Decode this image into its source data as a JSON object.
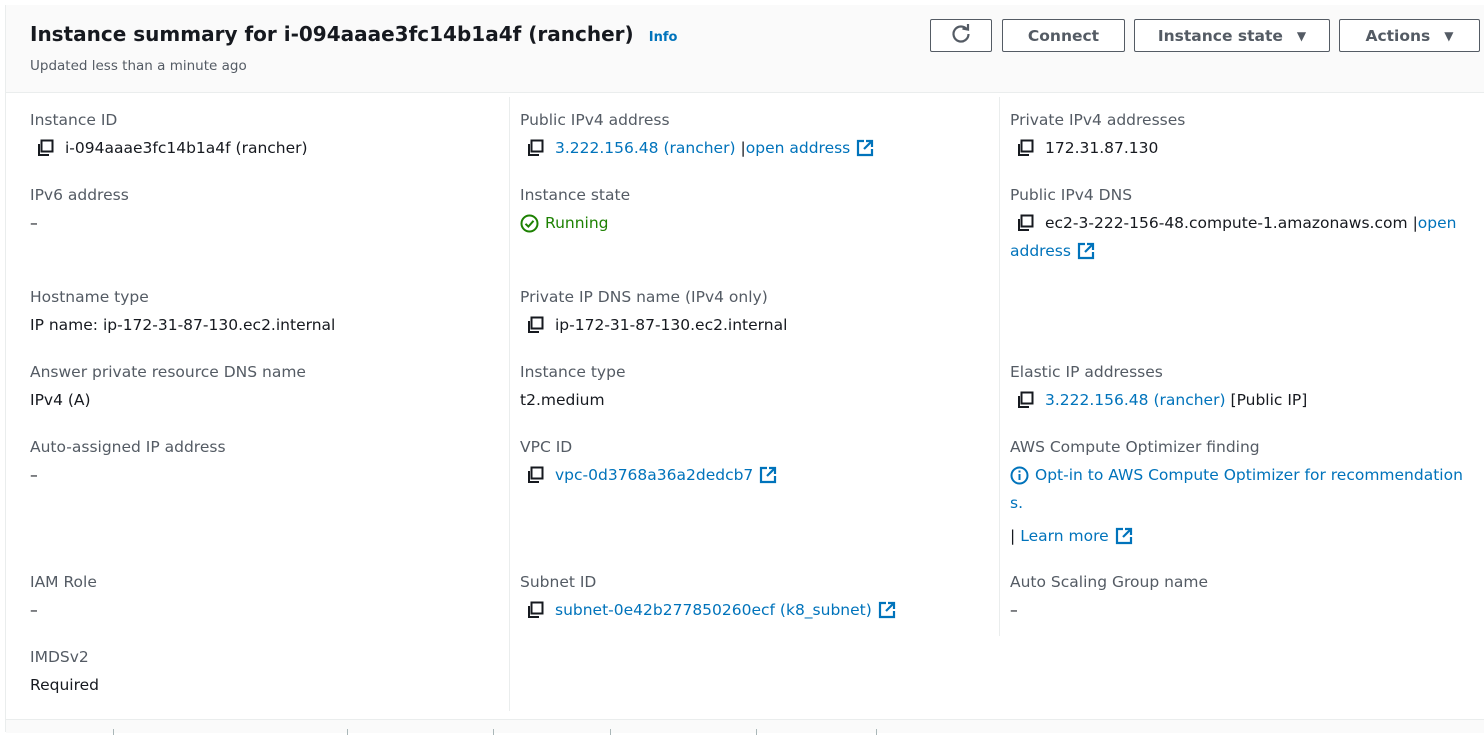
{
  "header": {
    "title": "Instance summary for i-094aaae3fc14b1a4f (rancher)",
    "info_label": "Info",
    "updated": "Updated less than a minute ago",
    "buttons": {
      "connect": "Connect",
      "instance_state": "Instance state",
      "actions": "Actions"
    }
  },
  "fields": {
    "instance_id": {
      "label": "Instance ID",
      "value": "i-094aaae3fc14b1a4f (rancher)"
    },
    "public_ipv4": {
      "label": "Public IPv4 address",
      "value": "3.222.156.48 (rancher)",
      "separator": "|",
      "open_address": "open address"
    },
    "private_ipv4": {
      "label": "Private IPv4 addresses",
      "value": "172.31.87.130"
    },
    "ipv6": {
      "label": "IPv6 address",
      "value": "–"
    },
    "instance_state": {
      "label": "Instance state",
      "value": "Running"
    },
    "public_dns": {
      "label": "Public IPv4 DNS",
      "value": "ec2-3-222-156-48.compute-1.amazonaws.com",
      "separator": "|",
      "open_address_1": "open",
      "open_address_2": "address"
    },
    "hostname_type": {
      "label": "Hostname type",
      "value": "IP name: ip-172-31-87-130.ec2.internal"
    },
    "private_dns": {
      "label": "Private IP DNS name (IPv4 only)",
      "value": "ip-172-31-87-130.ec2.internal"
    },
    "answer_dns": {
      "label": "Answer private resource DNS name",
      "value": "IPv4 (A)"
    },
    "instance_type": {
      "label": "Instance type",
      "value": "t2.medium"
    },
    "elastic_ip": {
      "label": "Elastic IP addresses",
      "value": "3.222.156.48 (rancher)",
      "suffix": "[Public IP]"
    },
    "auto_ip": {
      "label": "Auto-assigned IP address",
      "value": "–"
    },
    "vpc_id": {
      "label": "VPC ID",
      "value": "vpc-0d3768a36a2dedcb7"
    },
    "optimizer": {
      "label": "AWS Compute Optimizer finding",
      "line1": "Opt-in to AWS Compute Optimizer for recommendation",
      "line2": "s.",
      "separator": "|",
      "learn_more": "Learn more"
    },
    "iam_role": {
      "label": "IAM Role",
      "value": "–"
    },
    "subnet_id": {
      "label": "Subnet ID",
      "value": "subnet-0e42b277850260ecf (k8_subnet)"
    },
    "asg_name": {
      "label": "Auto Scaling Group name",
      "value": "–"
    },
    "imdsv2": {
      "label": "IMDSv2",
      "value": "Required"
    }
  },
  "colors": {
    "link": "#0073bb",
    "running": "#1d8102",
    "label": "#545b64",
    "text": "#16191f"
  },
  "icons": [
    "refresh-icon",
    "caret-down-icon",
    "copy-icon",
    "external-link-icon",
    "check-circle-icon",
    "info-circle-icon"
  ]
}
